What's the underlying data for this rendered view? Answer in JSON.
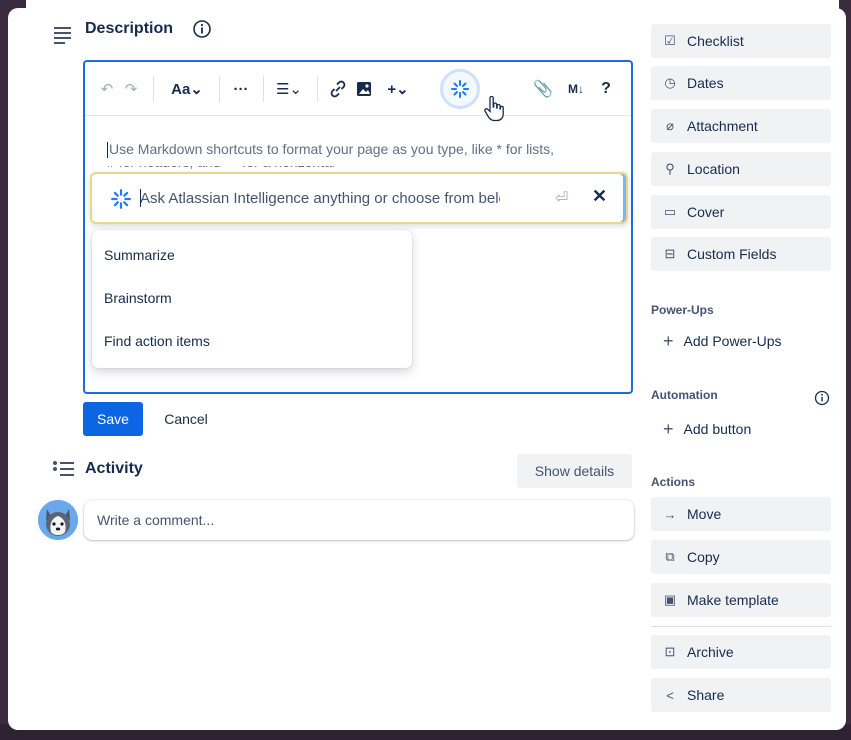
{
  "description": {
    "title": "Description",
    "placeholder_text": "Use Markdown shortcuts to format your page as you type, like * for lists,",
    "placeholder_cutoff": "# for headers, and --- for a horizontal rule."
  },
  "toolbar": {
    "undo": "↶",
    "redo": "↷",
    "text_style": "Aa⌄",
    "more": "···",
    "list": "☰⌄",
    "link": "🔗",
    "image": "▣",
    "insert": "+⌄",
    "attach": "📎",
    "markdown": "M↓",
    "help": "?"
  },
  "ai_prompt": {
    "placeholder": "Ask Atlassian Intelligence anything or choose from below",
    "enter_glyph": "⏎",
    "close_glyph": "✕"
  },
  "suggestions": [
    "Summarize",
    "Brainstorm",
    "Find action items"
  ],
  "actions_row": {
    "save": "Save",
    "cancel": "Cancel"
  },
  "activity": {
    "title": "Activity",
    "show_details": "Show details",
    "comment_placeholder": "Write a comment..."
  },
  "sidebar": {
    "add_to_card": [
      {
        "label": "Checklist",
        "icon": "checkbox-icon"
      },
      {
        "label": "Dates",
        "icon": "clock-icon"
      },
      {
        "label": "Attachment",
        "icon": "paperclip-icon"
      },
      {
        "label": "Location",
        "icon": "pin-icon"
      },
      {
        "label": "Cover",
        "icon": "cover-icon"
      },
      {
        "label": "Custom Fields",
        "icon": "custom-fields-icon"
      }
    ],
    "power_ups_heading": "Power-Ups",
    "add_power_ups": "Add Power-Ups",
    "automation_heading": "Automation",
    "add_button": "Add button",
    "actions_heading": "Actions",
    "actions": [
      {
        "label": "Move",
        "icon": "arrow-right-icon"
      },
      {
        "label": "Copy",
        "icon": "copy-icon"
      },
      {
        "label": "Make template",
        "icon": "template-icon"
      },
      {
        "label": "Archive",
        "icon": "archive-icon"
      },
      {
        "label": "Share",
        "icon": "share-icon"
      }
    ]
  },
  "colors": {
    "accent": "#0c66e4",
    "editor_border": "#1d6ae5",
    "button_bg": "#f1f2f4",
    "board_bg": "#3a2b3f"
  }
}
